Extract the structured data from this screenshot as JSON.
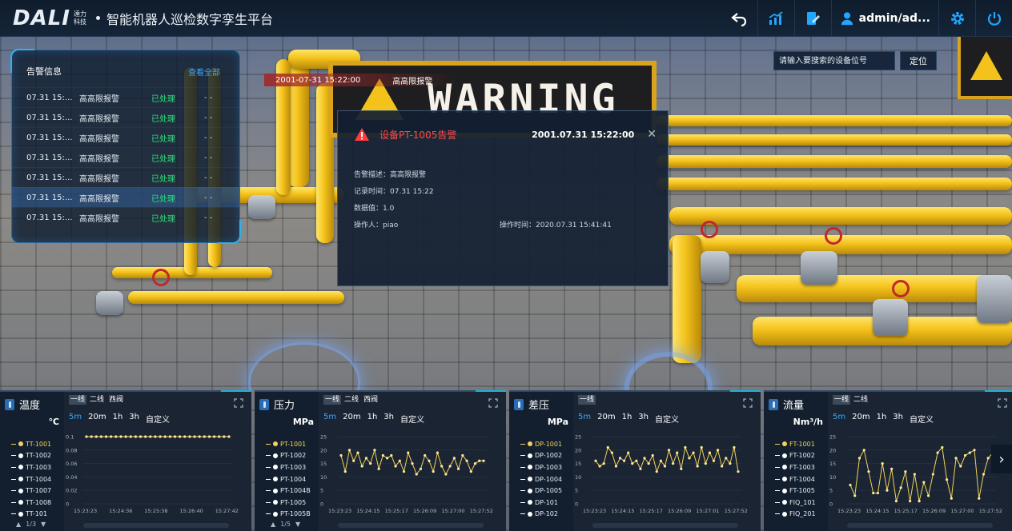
{
  "header": {
    "logo_mark": "DALI",
    "logo_cn_top": "達力",
    "logo_cn_bottom": "科技",
    "title": "智能机器人巡检数字孪生平台",
    "user": "admin/ad..."
  },
  "scene": {
    "warning_text": "WARNING"
  },
  "search": {
    "placeholder": "请输入要搜索的设备位号",
    "button": "定位"
  },
  "alarm_panel": {
    "title": "告警信息",
    "view_all": "查看全部",
    "rows": [
      {
        "time": "07.31 15:...",
        "type": "高高限报警",
        "status": "已处理",
        "value": "- -"
      },
      {
        "time": "07.31 15:...",
        "type": "高高限报警",
        "status": "已处理",
        "value": "- -"
      },
      {
        "time": "07.31 15:...",
        "type": "高高限报警",
        "status": "已处理",
        "value": "- -"
      },
      {
        "time": "07.31 15:...",
        "type": "高高限报警",
        "status": "已处理",
        "value": "- -"
      },
      {
        "time": "07.31 15:...",
        "type": "高高限报警",
        "status": "已处理",
        "value": "- -"
      },
      {
        "time": "07.31 15:...",
        "type": "高高限报警",
        "status": "已处理",
        "value": "- -"
      },
      {
        "time": "07.31 15:...",
        "type": "高高限报警",
        "status": "已处理",
        "value": "- -"
      }
    ]
  },
  "tag": {
    "time": "2001-07-31 15:22:00",
    "type": "高高限报警"
  },
  "dialog": {
    "title": "设备PT-1005告警",
    "time": "2001.07.31 15:22:00",
    "close": "✕",
    "desc": "告警描述：高高限报警",
    "record": "记录时间：07.31 15:22",
    "value": "数据值：1.0",
    "operator": "操作人：piao",
    "op_time": "操作时间：2020.07.31 15:41:41"
  },
  "panels": [
    {
      "title": "温度",
      "unit": "℃",
      "line_tabs": [
        "一线",
        "二线",
        "西阀"
      ],
      "active_line": 0,
      "range_tabs": [
        "5m",
        "20m",
        "1h",
        "3h",
        "自定义"
      ],
      "active_range": 0,
      "sensors": [
        "TT-1001",
        "TT-1002",
        "TT-1003",
        "TT-1004",
        "TT-1007",
        "TT-1008",
        "TT-101"
      ],
      "active_sensor": 0,
      "pager": "1/3"
    },
    {
      "title": "压力",
      "unit": "MPa",
      "line_tabs": [
        "一线",
        "二线",
        "西阀"
      ],
      "active_line": 0,
      "range_tabs": [
        "5m",
        "20m",
        "1h",
        "3h",
        "自定义"
      ],
      "active_range": 0,
      "sensors": [
        "PT-1001",
        "PT-1002",
        "PT-1003",
        "PT-1004",
        "PT-1004B",
        "PT-1005",
        "PT-1005B"
      ],
      "active_sensor": 0,
      "pager": "1/5"
    },
    {
      "title": "差压",
      "unit": "MPa",
      "line_tabs": [
        "一线"
      ],
      "active_line": 0,
      "range_tabs": [
        "5m",
        "20m",
        "1h",
        "3h",
        "自定义"
      ],
      "active_range": 0,
      "sensors": [
        "DP-1001",
        "DP-1002",
        "DP-1003",
        "DP-1004",
        "DP-1005",
        "DP-101",
        "DP-102"
      ],
      "active_sensor": 0,
      "pager": ""
    },
    {
      "title": "流量",
      "unit": "Nm³/h",
      "line_tabs": [
        "一线",
        "二线"
      ],
      "active_line": 0,
      "range_tabs": [
        "5m",
        "20m",
        "1h",
        "3h",
        "自定义"
      ],
      "active_range": 0,
      "sensors": [
        "FT-1001",
        "FT-1002",
        "FT-1003",
        "FT-1004",
        "FT-1005",
        "FIQ_101",
        "FIQ_201"
      ],
      "active_sensor": 0,
      "pager": ""
    }
  ],
  "chart_data": [
    {
      "type": "line",
      "x_ticks": [
        "15:23:23",
        "15:24:36",
        "15:25:38",
        "15:26:40",
        "15:27:42"
      ],
      "y_ticks": [
        "0.1",
        "0.08",
        "0.06",
        "0.04",
        "0.02",
        "0"
      ],
      "ylim": [
        0,
        0.1
      ],
      "series": [
        {
          "values": [
            0.1,
            0.1,
            0.1,
            0.1,
            0.1,
            0.1,
            0.1,
            0.1,
            0.1,
            0.1,
            0.1,
            0.1,
            0.1,
            0.1,
            0.1,
            0.1,
            0.1,
            0.1,
            0.1,
            0.1,
            0.1,
            0.1,
            0.1,
            0.1,
            0.1,
            0.1,
            0.1,
            0.1,
            0.1,
            0.1
          ]
        }
      ],
      "color": "#f3d35a"
    },
    {
      "type": "line",
      "x_ticks": [
        "15:23:23",
        "15:24:15",
        "15:25:17",
        "15:26:09",
        "15:27:00",
        "15:27:52"
      ],
      "y_ticks": [
        "25",
        "20",
        "15",
        "10",
        "5",
        "0"
      ],
      "ylim": [
        0,
        25
      ],
      "series": [
        {
          "values": [
            18,
            12,
            20,
            16,
            19,
            14,
            17,
            15,
            20,
            13,
            18,
            17,
            18,
            14,
            16,
            12,
            19,
            15,
            11,
            13,
            18,
            16,
            12,
            19,
            14,
            11,
            14,
            17,
            13,
            18,
            16,
            12,
            15,
            16,
            16
          ]
        }
      ],
      "color": "#f3d35a"
    },
    {
      "type": "line",
      "x_ticks": [
        "15:23:23",
        "15:24:15",
        "15:25:17",
        "15:26:09",
        "15:27:01",
        "15:27:52"
      ],
      "y_ticks": [
        "25",
        "20",
        "15",
        "10",
        "5",
        "0"
      ],
      "ylim": [
        0,
        25
      ],
      "series": [
        {
          "values": [
            16,
            14,
            15,
            21,
            19,
            14,
            17,
            16,
            19,
            15,
            16,
            13,
            17,
            15,
            18,
            12,
            16,
            14,
            20,
            15,
            19,
            13,
            21,
            17,
            19,
            14,
            21,
            15,
            19,
            16,
            20,
            14,
            17,
            15,
            21,
            12
          ]
        }
      ],
      "color": "#f3d35a"
    },
    {
      "type": "line",
      "x_ticks": [
        "15:23:23",
        "15:24:15",
        "15:25:17",
        "15:26:09",
        "15:27:00",
        "15:27:52"
      ],
      "y_ticks": [
        "25",
        "20",
        "15",
        "10",
        "5",
        "0"
      ],
      "ylim": [
        0,
        25
      ],
      "series": [
        {
          "values": [
            7,
            3,
            17,
            20,
            12,
            4,
            4,
            15,
            5,
            13,
            1,
            6,
            12,
            1,
            11,
            1,
            8,
            3,
            11,
            19,
            21,
            9,
            2,
            17,
            14,
            18,
            19,
            20,
            2,
            11,
            17,
            19
          ]
        }
      ],
      "color": "#f3d35a"
    }
  ]
}
